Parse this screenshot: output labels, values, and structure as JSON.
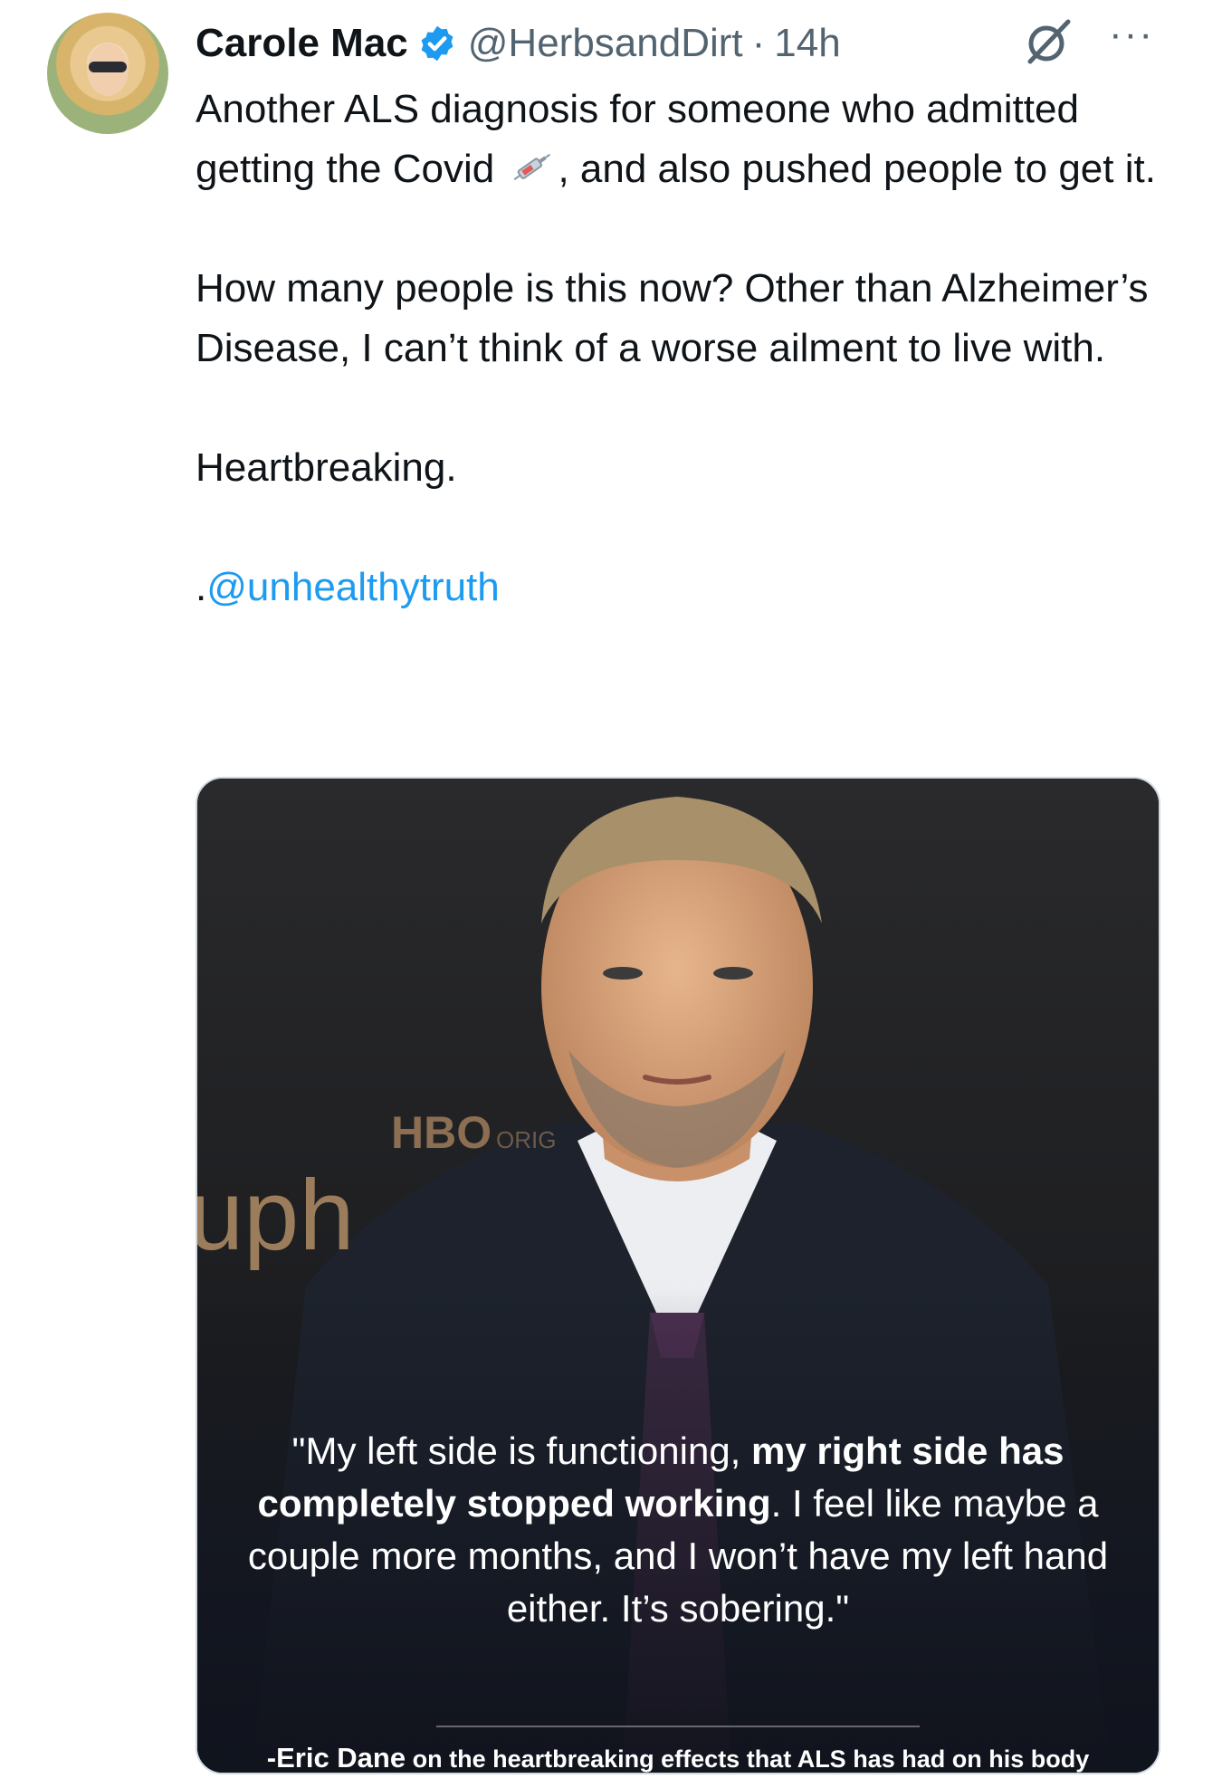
{
  "tweet": {
    "author_name": "Carole Mac",
    "handle": "@HerbsandDirt",
    "separator": "·",
    "time": "14h",
    "more_label": "···",
    "text_line1_a": "Another ALS diagnosis for someone who admitted getting the Covid",
    "text_line1_b": ", and also pushed people to get it.",
    "text_p2": "How many people is this now? Other than Alzheimer’s Disease, I can’t think of a worse ailment to live with.",
    "text_p3": "Heartbreaking.",
    "mention_prefix": ".",
    "mention": "@unhealthytruth"
  },
  "media": {
    "sign_text_1": "HBO",
    "sign_text_2": "ORIG",
    "sign_text_3": "uph",
    "quote_1": "\"My left side is functioning, ",
    "quote_bold": "my right side has completely stopped working",
    "quote_2": ". I feel like maybe a couple more months, and I won’t have my left hand either. It’s sobering.\"",
    "caption_name": "-Eric Dane",
    "caption_rest": " on the heartbreaking effects that ALS has had on his body"
  },
  "colors": {
    "accent": "#1d9bf0",
    "secondary_text": "#536471",
    "primary_text": "#0f1419"
  },
  "icons": {
    "verified": "verified-badge-icon",
    "grok": "grok-icon",
    "more": "more-options-icon",
    "syringe": "syringe-emoji-icon"
  }
}
